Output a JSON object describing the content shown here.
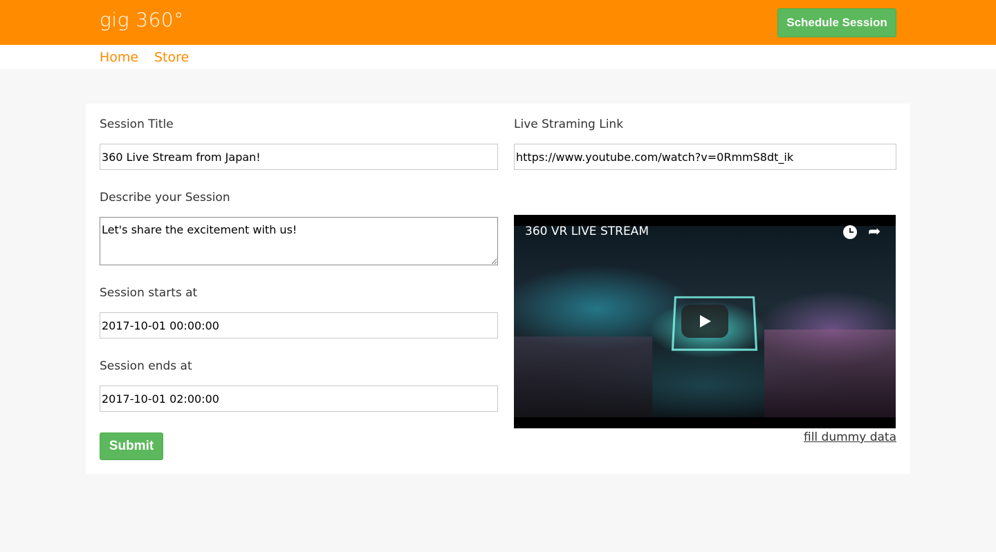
{
  "header": {
    "logo": "gig 360°",
    "schedule_button": "Schedule Session"
  },
  "nav": {
    "home": "Home",
    "store": "Store"
  },
  "form": {
    "title_label": "Session Title",
    "title_value": "360 Live Stream from Japan!",
    "description_label": "Describe your Session",
    "description_value": "Let's share the excitement with us!",
    "starts_label": "Session starts at",
    "starts_value": "2017-10-01 00:00:00",
    "ends_label": "Session ends at",
    "ends_value": "2017-10-01 02:00:00",
    "submit": "Submit",
    "link_label": "Live Straming Link",
    "link_value": "https://www.youtube.com/watch?v=0RmmS8dt_ik",
    "fill_dummy": "fill dummy data"
  },
  "video": {
    "title": "360 VR LIVE STREAM",
    "icons": [
      "clock-icon",
      "share-icon",
      "play-icon"
    ]
  },
  "colors": {
    "brand": "#ff8c00",
    "success": "#5cb85c",
    "background": "#f7f7f7"
  }
}
